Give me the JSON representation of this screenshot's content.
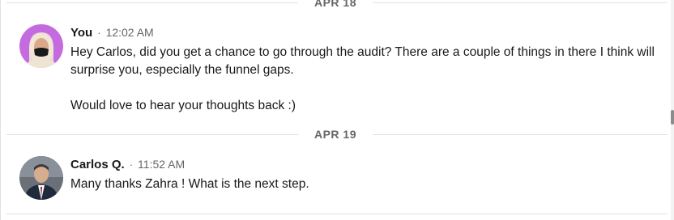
{
  "dividers": [
    {
      "label": "APR 18"
    },
    {
      "label": "APR 19"
    }
  ],
  "messages": [
    {
      "sender": "You",
      "separator": "·",
      "time": "12:02 AM",
      "paragraphs": [
        "Hey Carlos, did you get a chance to go through the audit? There are a couple of things in there I think will surprise you, especially the funnel gaps.",
        "Would love to hear your thoughts back :)"
      ]
    },
    {
      "sender": "Carlos Q.",
      "separator": "·",
      "time": "11:52 AM",
      "paragraphs": [
        "Many thanks Zahra ! What is the next step."
      ]
    }
  ],
  "colors": {
    "avatar_you_bg": "#c56be0",
    "avatar_carlos_bg": "#6b7078",
    "divider_text": "#666666",
    "divider_line": "#e0e0e0"
  }
}
